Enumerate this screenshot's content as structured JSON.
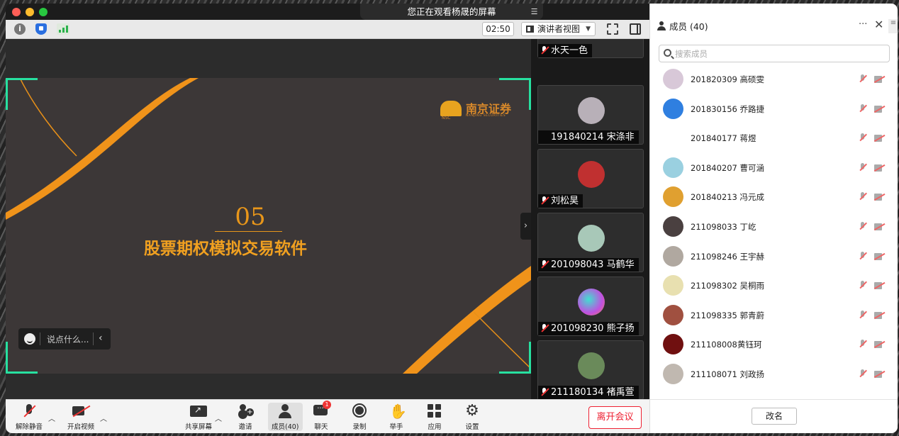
{
  "window": {
    "banner": "您正在观看杨晟的屏幕",
    "timer": "02:50",
    "view_mode": "演讲者视图"
  },
  "slide": {
    "number": "05",
    "title": "股票期权模拟交易软件",
    "logo_name": "南京证券",
    "logo_sub": "NANJING SECURITIES",
    "logo_mark": "NSC",
    "accent_color": "#f0a020"
  },
  "chat_input": {
    "placeholder": "说点什么..."
  },
  "video_tiles": [
    {
      "name": "水天一色",
      "avatar_color": "#8a6a5a"
    },
    {
      "name": "191840214 宋涤非",
      "avatar_color": "#b8b0b8"
    },
    {
      "name": "刘松昊",
      "avatar_color": "#c03030"
    },
    {
      "name": "201098043 马鹤华",
      "avatar_color": "#a8c8b8"
    },
    {
      "name": "201098230 熊子扬",
      "avatar_color": "#c050e0"
    },
    {
      "name": "211180134 褚禹萱",
      "avatar_color": "#6a8a5a"
    }
  ],
  "bottombar": {
    "mute": "解除静音",
    "video": "开启视频",
    "share": "共享屏幕",
    "invite": "邀请",
    "members": "成员(40)",
    "chat": "聊天",
    "chat_badge": "1",
    "record": "录制",
    "raise_hand": "举手",
    "apps": "应用",
    "settings": "设置",
    "leave": "离开会议"
  },
  "panel": {
    "title": "成员 (40)",
    "search_placeholder": "搜索成员",
    "members": [
      {
        "name": "201820309 高硕雯",
        "avatar_color": "#d8c8d8"
      },
      {
        "name": "201830156 乔路捷",
        "avatar_color": "#2f7fe0"
      },
      {
        "name": "201840177 蒋煜",
        "avatar_color": "#ffffff"
      },
      {
        "name": "201840207 曹可涵",
        "avatar_color": "#9ad0e0"
      },
      {
        "name": "201840213 冯元成",
        "avatar_color": "#e0a030"
      },
      {
        "name": "211098033 丁屹",
        "avatar_color": "#4a4040"
      },
      {
        "name": "211098246 王宇赫",
        "avatar_color": "#b0a8a0"
      },
      {
        "name": "211098302 吴桐雨",
        "avatar_color": "#e8e0b0"
      },
      {
        "name": "211098335 郭青蔚",
        "avatar_color": "#a05040"
      },
      {
        "name": "211108008黄钰珂",
        "avatar_color": "#701010"
      },
      {
        "name": "211108071 刘政扬",
        "avatar_color": "#c0b8b0"
      }
    ],
    "rename": "改名"
  }
}
